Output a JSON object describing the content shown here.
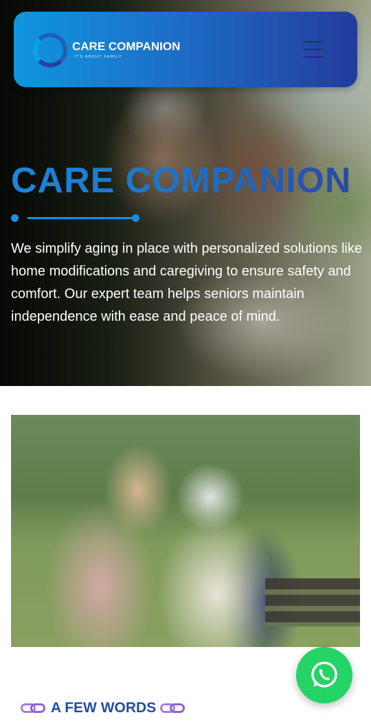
{
  "brand": {
    "name": "CARE COMPANION",
    "tagline": "IT'S ABOUT FAMILY"
  },
  "navbar": {
    "menu_icon": "hamburger-menu-icon"
  },
  "hero": {
    "title": "CARE COMPANION",
    "description": "We simplify aging in place with personalized solutions like home modifications and caregiving to ensure safety and comfort. Our expert team helps seniors maintain independence with ease and peace of mind."
  },
  "fab": {
    "icon": "whatsapp-icon",
    "color": "#25d366"
  },
  "section": {
    "heading": "A FEW WORDS"
  },
  "colors": {
    "accent": "#1c8ee0",
    "nav_gradient_start": "#1096dc",
    "nav_gradient_end": "#233c9c",
    "heading": "#1f4fa6"
  }
}
